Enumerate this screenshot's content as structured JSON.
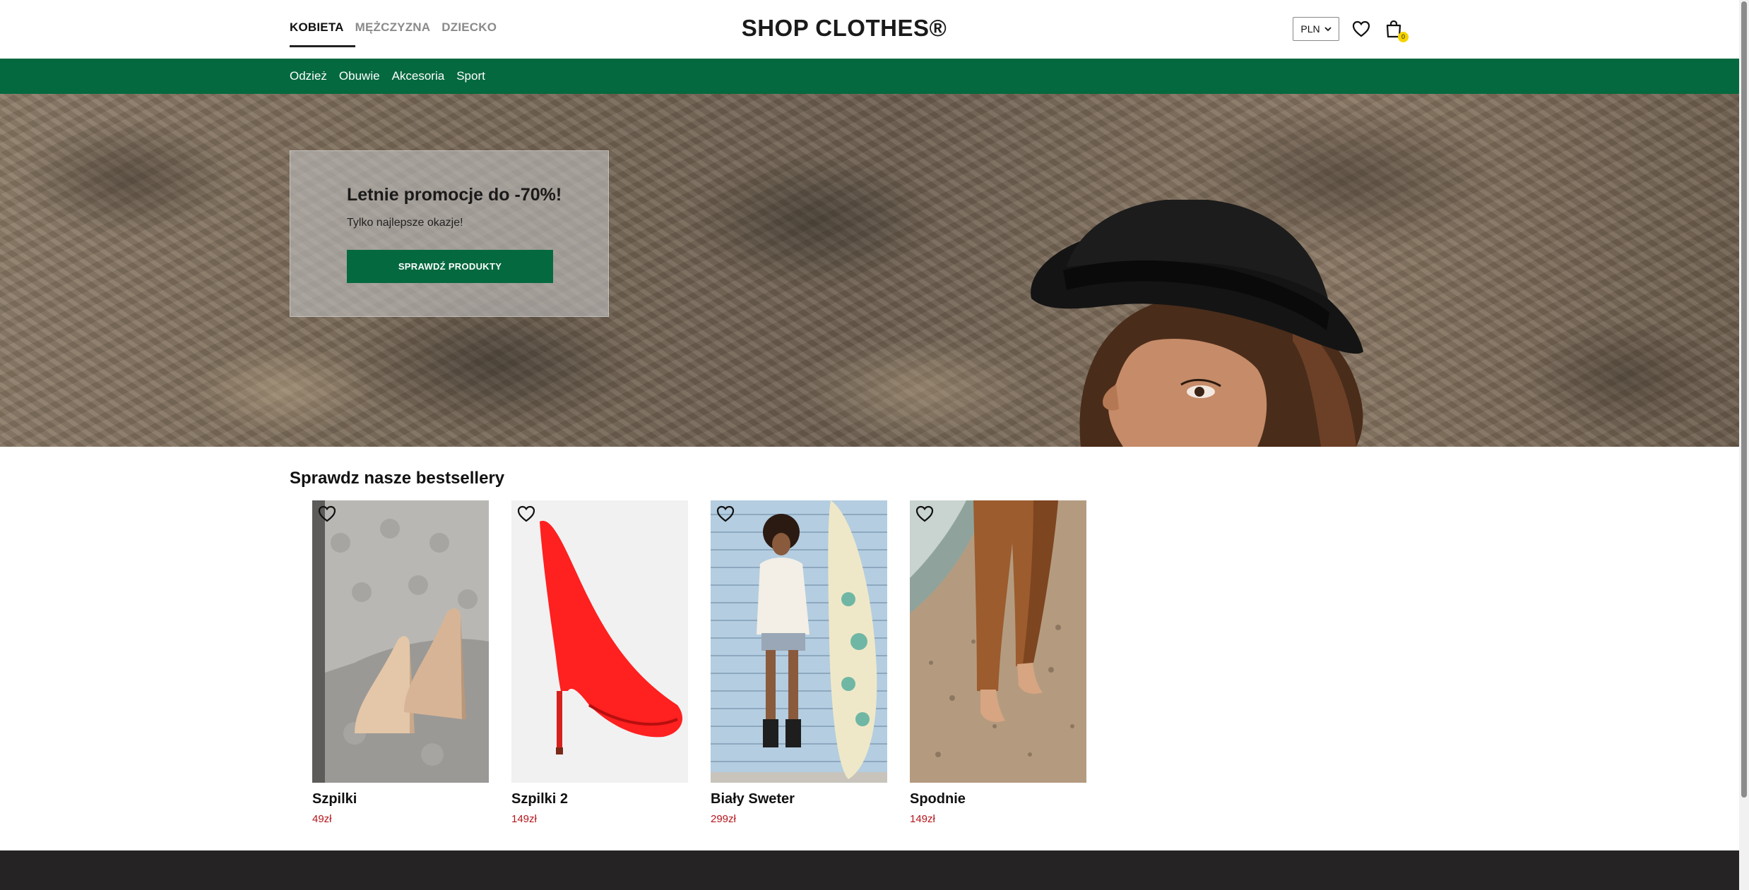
{
  "header": {
    "gender_tabs": [
      {
        "label": "KOBIETA",
        "active": true
      },
      {
        "label": "MĘŻCZYZNA",
        "active": false
      },
      {
        "label": "DZIECKO",
        "active": false
      }
    ],
    "logo": "SHOP CLOTHES®",
    "currency": {
      "selected": "PLN"
    },
    "cart_count": "0",
    "icons": [
      "heart-icon",
      "shopping-bag-icon"
    ]
  },
  "categories": [
    "Odzież",
    "Obuwie",
    "Akcesoria",
    "Sport"
  ],
  "hero": {
    "title": "Letnie promocje do -70%!",
    "subtitle": "Tylko najlepsze okazje!",
    "button": "SPRAWDŹ PRODUKTY"
  },
  "bestsellers": {
    "title": "Sprawdz nasze bestsellery",
    "products": [
      {
        "name": "Szpilki",
        "price": "49zł"
      },
      {
        "name": "Szpilki 2",
        "price": "149zł"
      },
      {
        "name": "Biały Sweter",
        "price": "299zł"
      },
      {
        "name": "Spodnie",
        "price": "149zł"
      }
    ]
  },
  "colors": {
    "brand_green": "#04693f",
    "price_red": "#b4151b",
    "cart_badge": "#f5d400",
    "footer": "#252323"
  }
}
